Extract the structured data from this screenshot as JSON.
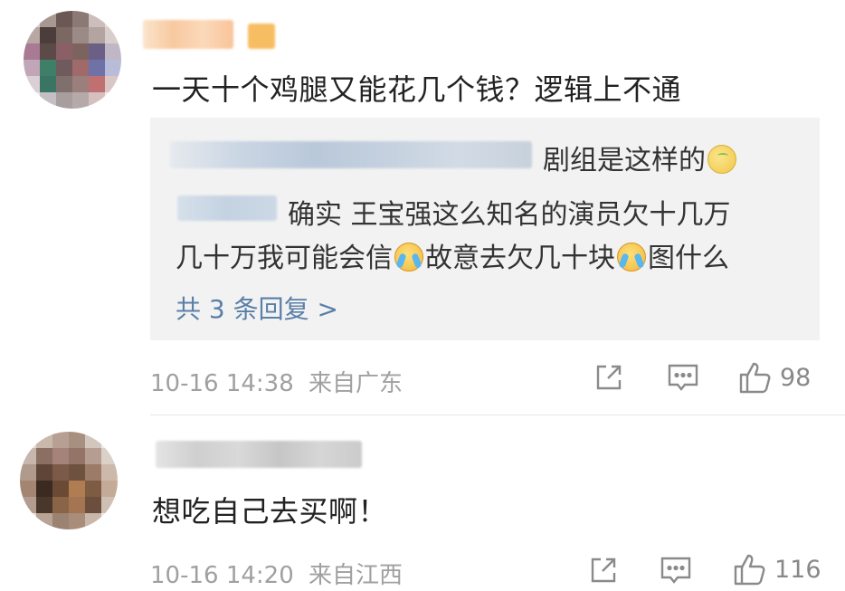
{
  "comments": [
    {
      "text": "一天十个鸡腿又能花几个钱？逻辑上不通",
      "replies": [
        {
          "text": "剧组是这样的",
          "emoji": "smile-emoji"
        },
        {
          "text": "确实 王宝强这么知名的演员欠十几万"
        },
        {
          "text_a": "几十万我可能会信",
          "text_b": "故意去欠几十块",
          "text_c": "图什么",
          "emoji": "laugh-cry-emoji"
        }
      ],
      "more_replies": "共 3 条回复 >",
      "time": "10-16 14:38",
      "location": "来自广东",
      "likes": "98"
    },
    {
      "text": "想吃自己去买啊！",
      "time": "10-16 14:20",
      "location": "来自江西",
      "likes": "116"
    }
  ],
  "icons": [
    "share-icon",
    "comment-icon",
    "like-icon"
  ],
  "colors": {
    "link": "#5a7fa8",
    "meta": "#a0a0a0",
    "reply_bg": "#f2f2f2"
  }
}
